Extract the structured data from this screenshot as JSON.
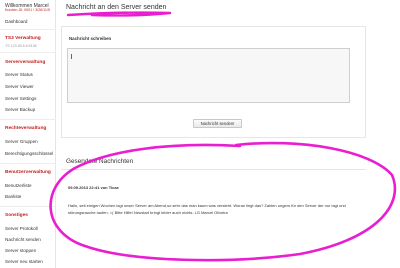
{
  "sidebar": {
    "welcome": "Willkommen Marcel",
    "user_line": "Kunden-ID: 0001 / 3/26/11/5",
    "dashboard": "Dashboard",
    "ts3_heading": "TS3 Verwaltung",
    "ts3_sub": "TS 123.45.6.8:9136",
    "server_heading": "Serververwaltung",
    "server_items": [
      "Server Status",
      "Server Viewer",
      "Server Settings",
      "Server Backup"
    ],
    "rights_heading": "Rechteverwaltung",
    "rights_items": [
      "Server Gruppen",
      "Berechtigungsschlüssel"
    ],
    "user_heading": "Benutzerverwaltung",
    "user_items": [
      "Benutzerliste",
      "Banliste"
    ],
    "misc_heading": "Sonstiges",
    "misc_items": [
      "Server Protokoll",
      "Nachricht senden",
      "Server stoppen",
      "Server neu starten"
    ]
  },
  "main": {
    "title": "Nachricht an den Server senden",
    "write_label": "Nachricht schreiben",
    "message_value": "",
    "send_label": "Nachricht senden!",
    "sent_title": "Gesendete Nachrichten",
    "sent_meta": "09.09.2013 22:41 von Ticae",
    "sent_body": "Hallo, seit einigen Wochen lagt unser Server am Abend,so sehr das man kaum was versteht. Woran liegt das? Zahlen ungern für den Server der nur lagt und störungsrauche laufen. =( Bitte Hilfe! Neustart bringt leider auch nichts. LG Marcel Oliveira"
  },
  "colors": {
    "accent_red": "#c62020",
    "highlight_pen": "#e81ed0"
  }
}
